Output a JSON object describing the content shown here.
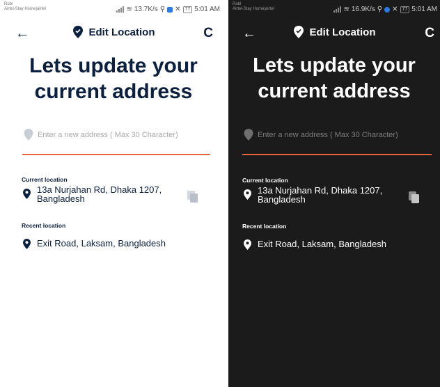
{
  "status": {
    "carrier_top": "Robi",
    "carrier_bottom": "Airtel-Stay Home|airtel",
    "time": "5:01 AM",
    "battery": "77"
  },
  "screens": [
    {
      "theme": "light",
      "net_speed": "13.7K/s",
      "title": "Edit Location",
      "headline_1": "Lets update your",
      "headline_2": "current address",
      "search_placeholder": "Enter a new address ( Max 30 Character)",
      "current_label": "Current location",
      "current_address": "13a Nurjahan Rd, Dhaka 1207, Bangladesh",
      "recent_label": "Recent location",
      "recent_address": "Exit Road, Laksam, Bangladesh"
    },
    {
      "theme": "dark",
      "net_speed": "16.9K/s",
      "title": "Edit Location",
      "headline_1": "Lets update your",
      "headline_2": "current address",
      "search_placeholder": "Enter a new address ( Max 30 Character)",
      "current_label": "Current location",
      "current_address": "13a Nurjahan Rd, Dhaka 1207, Bangladesh",
      "recent_label": "Recent location",
      "recent_address": "Exit Road, Laksam, Bangladesh"
    }
  ],
  "icons": {
    "back": "arrow-left-icon",
    "refresh": "refresh-icon",
    "pin": "location-pin-icon",
    "copy": "copy-icon"
  },
  "colors": {
    "light_text": "#0b1f3f",
    "dark_bg": "#1b1b1b",
    "accent_underline": "#e8643a",
    "placeholder_pin": "#c8cdd6",
    "copy_icon": "#b9bec8"
  }
}
